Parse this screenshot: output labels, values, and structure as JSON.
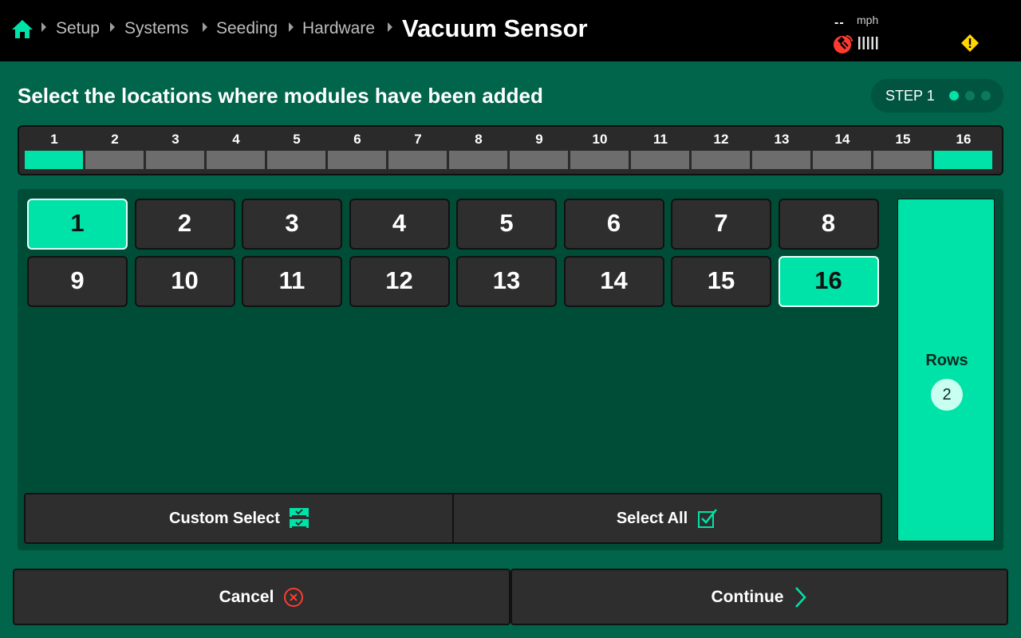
{
  "header": {
    "breadcrumbs": [
      "Setup",
      "Systems",
      "Seeding",
      "Hardware"
    ],
    "title": "Vacuum Sensor",
    "speed_value": "--",
    "speed_unit": "mph",
    "icons": [
      "home-icon",
      "satellite-icon",
      "signal-bars-icon",
      "warning-icon"
    ]
  },
  "instruction": "Select the locations where modules have been added",
  "step": {
    "label": "STEP 1",
    "current": 1,
    "total": 3
  },
  "location_bar": {
    "numbers": [
      "1",
      "2",
      "3",
      "4",
      "5",
      "6",
      "7",
      "8",
      "9",
      "10",
      "11",
      "12",
      "13",
      "14",
      "15",
      "16"
    ],
    "selected": [
      1,
      16
    ]
  },
  "modules": {
    "labels": [
      "1",
      "2",
      "3",
      "4",
      "5",
      "6",
      "7",
      "8",
      "9",
      "10",
      "11",
      "12",
      "13",
      "14",
      "15",
      "16"
    ],
    "selected": [
      1,
      16
    ]
  },
  "actions": {
    "custom_select": "Custom Select",
    "select_all": "Select All"
  },
  "rows": {
    "label": "Rows",
    "count": "2"
  },
  "footer": {
    "cancel": "Cancel",
    "continue": "Continue"
  },
  "colors": {
    "accent": "#00e3a8",
    "background": "#00654a",
    "panel": "#004d37",
    "button": "#2e2e2e",
    "warning": "#ffd600",
    "alert": "#ff3b30"
  }
}
